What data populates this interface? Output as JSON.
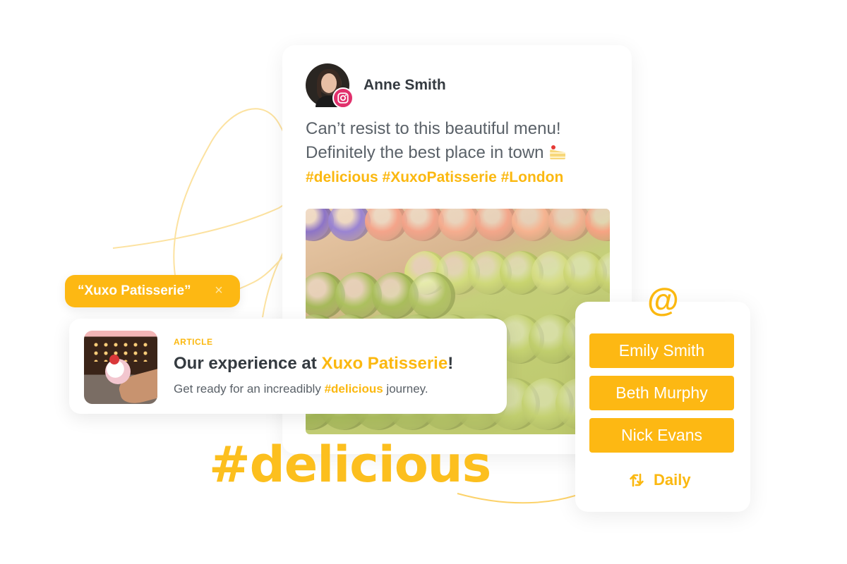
{
  "colors": {
    "accent": "#FDB813",
    "accent_text": "#FBB810",
    "instagram": "#E1306C",
    "text_dark": "#343A40",
    "text_body": "#5A6168",
    "squiggle": "#FCE2A0"
  },
  "post": {
    "author": "Anne Smith",
    "network_icon": "instagram-icon",
    "text_line1": "Can’t resist to this beautiful menu!",
    "text_line2": "Definitely the best place in town",
    "emoji": "cake-icon",
    "hashtags": "#delicious #XuxoPatisserie #London",
    "photo": "macarons-photo"
  },
  "search_chip": {
    "label": "“Xuxo Patisserie”",
    "close_glyph": "×"
  },
  "article": {
    "kicker": "ARTICLE",
    "title_prefix": "Our experience at ",
    "title_highlight": "Xuxo Patisserie",
    "title_suffix": "!",
    "desc_prefix": "Get ready for an increadibly ",
    "desc_highlight": "#delicious",
    "desc_suffix": " journey."
  },
  "big_hashtag": "#delicious",
  "mentions": {
    "icon_glyph": "@",
    "people": [
      "Emily Smith",
      "Beth Murphy",
      "Nick Evans"
    ],
    "schedule_label": "Daily",
    "schedule_icon": "repeat-icon"
  }
}
